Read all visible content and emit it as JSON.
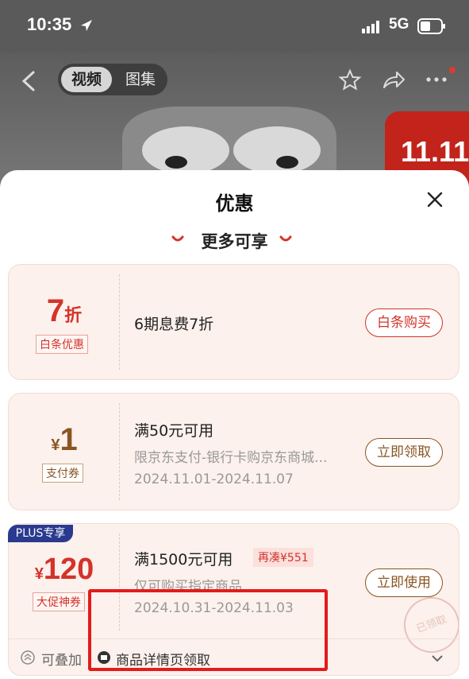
{
  "status_bar": {
    "time": "10:35",
    "network": "5G"
  },
  "header": {
    "tabs": [
      {
        "label": "视频",
        "active": true
      },
      {
        "label": "图集",
        "active": false
      }
    ],
    "icons": [
      "back-icon",
      "star-icon",
      "share-icon",
      "more-icon"
    ],
    "promo_badge": "11.11"
  },
  "sheet": {
    "title": "优惠",
    "section_title": "更多可享",
    "close_icon": "close-icon",
    "cards": [
      {
        "big_value": "7",
        "big_unit": "折",
        "tag": "白条优惠",
        "main_text": "6期息费7折",
        "action": "白条购买"
      },
      {
        "currency": "¥",
        "big_value": "1",
        "tag": "支付券",
        "main_text": "满50元可用",
        "desc": "限京东支付-银行卡购京东商城...",
        "date": "2024.11.01-2024.11.07",
        "action": "立即领取"
      },
      {
        "plus_badge": "PLUS专享",
        "currency": "¥",
        "big_value": "120",
        "tag": "大促神券",
        "main_text": "满1500元可用",
        "extra_tag": "再凑¥551",
        "desc": "仅可购买指定商品",
        "date": "2024.10.31-2024.11.03",
        "action": "立即使用",
        "stamp": "已领取"
      }
    ],
    "bottom": {
      "stack_label": "可叠加",
      "source_label": "商品详情页领取"
    }
  },
  "colors": {
    "accent": "#d3332b",
    "plus": "#2a3a8f",
    "card_bg": "#fcf1ec",
    "highlight": "#e31b1b"
  }
}
